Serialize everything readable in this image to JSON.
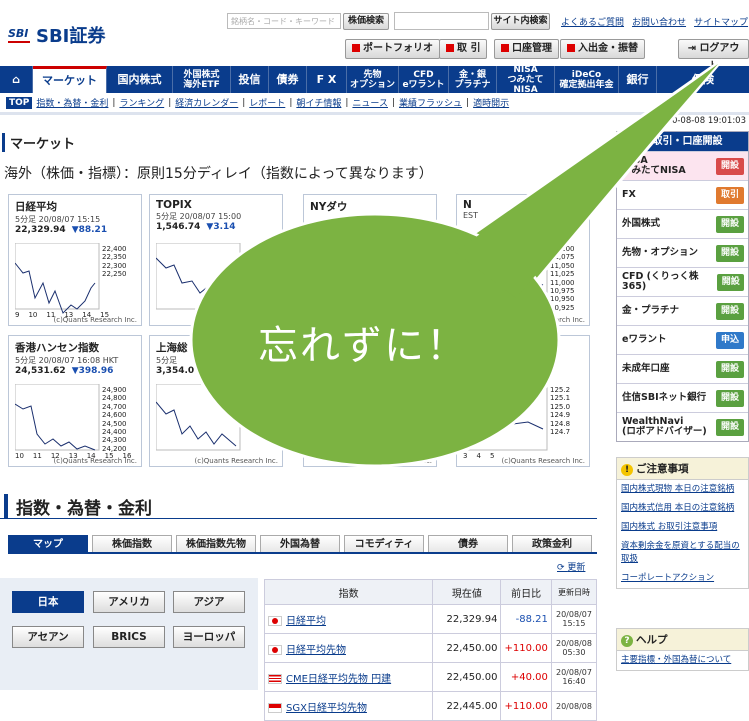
{
  "header": {
    "logo_mark": "SBI",
    "logo_text": "SBI証券",
    "search_placeholder": "銘柄名・コード・キーワード",
    "stock_search": "株価検索",
    "site_search": "サイト内検索",
    "links": [
      "よくあるご質問",
      "お問い合わせ",
      "サイトマップ"
    ],
    "portfolio": "ポートフォリオ",
    "trade": "取 引",
    "account": "口座管理",
    "deposit": "入出金・振替",
    "logout": "ログアウト"
  },
  "nav": {
    "items": [
      "マーケット",
      "国内株式",
      "外国株式\n海外ETF",
      "投信",
      "債券",
      "F X",
      "先物\nオプション",
      "CFD\neワラント",
      "金・銀\nプラチナ",
      "NISA\nつみたてNISA",
      "iDeCo\n確定拠出年金",
      "銀行",
      "保険"
    ]
  },
  "subnav": {
    "top": "TOP",
    "items": [
      "指数・為替・金利",
      "ランキング",
      "経済カレンダー",
      "レポート",
      "朝イチ情報",
      "ニュース",
      "業績フラッシュ",
      "適時開示"
    ]
  },
  "timestamp": "2020-08-08 19:01:03",
  "market": {
    "title": "マーケット",
    "delay_note": "海外（株価・指標）：原則15分ディレイ（指数によって異なります）",
    "credit": "(c)Quants Research Inc.",
    "charts": [
      {
        "title": "日経平均",
        "sub": "5分足 20/08/07 15:15",
        "value": "22,329.94",
        "change": "▼88.21",
        "yticks": [
          "22,400",
          "22,350",
          "22,300",
          "22,250"
        ],
        "xticks": [
          "9",
          "10",
          "11",
          "13",
          "14",
          "15"
        ]
      },
      {
        "title": "TOPIX",
        "sub": "5分足 20/08/07 15:00",
        "value": "1,546.74",
        "change": "▼3.14",
        "yticks": [],
        "xticks": []
      },
      {
        "title": "NYダウ",
        "sub": "",
        "value": "",
        "change": "",
        "yticks": [],
        "xticks": []
      },
      {
        "title": "N",
        "sub": "EST",
        "value": "",
        "change": "",
        "yticks": [
          "11,100",
          "11,075",
          "11,050",
          "11,025",
          "11,000",
          "10,975",
          "10,950",
          "10,925"
        ],
        "xticks": []
      },
      {
        "title": "香港ハンセン指数",
        "sub": "5分足 20/08/07 16:08 HKT",
        "value": "24,531.62",
        "change": "▼398.96",
        "yticks": [
          "24,900",
          "24,800",
          "24,700",
          "24,600",
          "24,500",
          "24,400",
          "24,300",
          "24,200"
        ],
        "xticks": [
          "10",
          "11",
          "12",
          "13",
          "14",
          "15",
          "16"
        ]
      },
      {
        "title": "上海総",
        "sub": "5分足",
        "value": "3,354.0",
        "change": "",
        "yticks": [],
        "xticks": []
      },
      {
        "title": "",
        "sub": "",
        "value": "",
        "change": "",
        "yticks": [],
        "xticks": []
      },
      {
        "title": "",
        "sub": "9",
        "value": "",
        "change": "",
        "yticks": [
          "125.2",
          "125.1",
          "125.0",
          "124.9",
          "124.8",
          "124.7"
        ],
        "xticks": [
          "3",
          "4",
          "5"
        ]
      }
    ]
  },
  "indices": {
    "title": "指数・為替・金利",
    "tabs": [
      "マップ",
      "株価指数",
      "株価指数先物",
      "外国為替",
      "コモディティ",
      "債券",
      "政策金利"
    ],
    "refresh": "更新",
    "regions": [
      "日本",
      "アメリカ",
      "アジア",
      "アセアン",
      "BRICS",
      "ヨーロッパ"
    ],
    "columns": [
      "指数",
      "現在値",
      "前日比",
      "更新日時"
    ],
    "rows": [
      {
        "name": "日経平均",
        "flag": "jp",
        "value": "22,329.94",
        "change": "-88.21",
        "dir": "neg",
        "date": "20/08/07",
        "time": "15:15"
      },
      {
        "name": "日経平均先物",
        "flag": "jp",
        "value": "22,450.00",
        "change": "+110.00",
        "dir": "pos",
        "date": "20/08/08",
        "time": "05:30"
      },
      {
        "name": "CME日経平均先物 円建",
        "flag": "us",
        "value": "22,450.00",
        "change": "+40.00",
        "dir": "pos",
        "date": "20/08/07",
        "time": "16:40"
      },
      {
        "name": "SGX日経平均先物",
        "flag": "sg",
        "value": "22,445.00",
        "change": "+110.00",
        "dir": "pos",
        "date": "20/08/08",
        "time": ""
      }
    ]
  },
  "side": {
    "head": "お取引・口座開設",
    "rows": [
      {
        "label": "NISA\nつみたてNISA",
        "btn": "開設",
        "color": "rd"
      },
      {
        "label": "FX",
        "btn": "取引",
        "color": "or"
      },
      {
        "label": "外国株式",
        "btn": "開設",
        "color": "gr"
      },
      {
        "label": "先物・オプション",
        "btn": "開設",
        "color": "gr"
      },
      {
        "label": "CFD (くりっく株365)",
        "btn": "開設",
        "color": "gr"
      },
      {
        "label": "金・プラチナ",
        "btn": "開設",
        "color": "gr"
      },
      {
        "label": "eワラント",
        "btn": "申込",
        "color": "bl"
      },
      {
        "label": "未成年口座",
        "btn": "開設",
        "color": "gr"
      },
      {
        "label": "住信SBIネット銀行",
        "btn": "開設",
        "color": "gr"
      },
      {
        "label": "WealthNavi\n(ロボアドバイザー)",
        "btn": "開設",
        "color": "gr"
      }
    ],
    "notice_head": "ご注意事項",
    "notices": [
      "国内株式現物 本日の注意銘柄",
      "国内株式信用 本日の注意銘柄",
      "国内株式 お取引注意事項",
      "資本剰余金を原資とする配当の取扱",
      "コーポレートアクション"
    ],
    "help_head": "ヘルプ",
    "help_items": [
      "主要指標・外国為替について"
    ]
  },
  "overlay": {
    "text": "忘れずに！"
  }
}
